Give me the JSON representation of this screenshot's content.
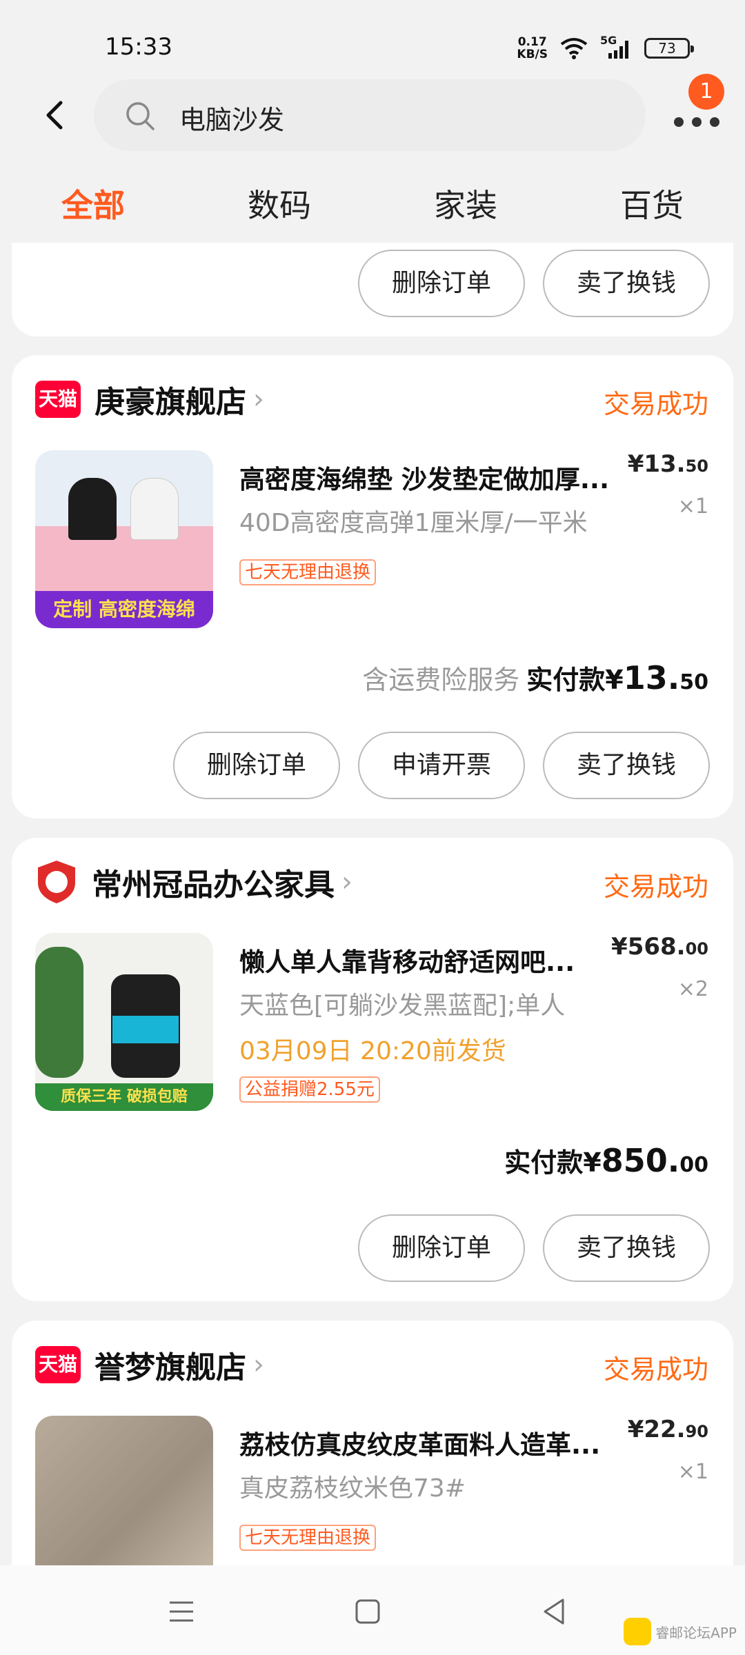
{
  "status": {
    "time": "15:33",
    "net_speed_value": "0.17",
    "net_speed_unit": "KB/S",
    "network": "5G",
    "battery": "73"
  },
  "header": {
    "search_text": "电脑沙发",
    "badge_count": "1"
  },
  "tabs": [
    {
      "label": "全部",
      "active": true
    },
    {
      "label": "数码",
      "active": false
    },
    {
      "label": "家装",
      "active": false
    },
    {
      "label": "百货",
      "active": false
    }
  ],
  "card0": {
    "btn_delete": "删除订单",
    "btn_sell": "卖了换钱"
  },
  "card1": {
    "shop_logo": "天猫",
    "shop_name": "庚豪旗舰店",
    "status": "交易成功",
    "thumb_text": "定制 高密度海绵",
    "title": "高密度海绵垫 沙发垫定做加厚...",
    "spec": "40D高密度高弹1厘米厚/一平米",
    "tag": "七天无理由退换",
    "price_int": "¥13.",
    "price_dec": "50",
    "qty": "×1",
    "pay_note": "含运费险服务",
    "pay_label": "实付款¥",
    "pay_int": "13.",
    "pay_dec": "50",
    "btn_delete": "删除订单",
    "btn_invoice": "申请开票",
    "btn_sell": "卖了换钱"
  },
  "card2": {
    "shop_logo": "企",
    "shop_name": "常州冠品办公家具",
    "status": "交易成功",
    "thumb_text": "质保三年 破损包赔",
    "title": "懒人单人靠背移动舒适网吧...",
    "spec": "天蓝色[可躺沙发黑蓝配];单人",
    "ship": "03月09日 20:20前发货",
    "tag": "公益捐赠2.55元",
    "price_int": "¥568.",
    "price_dec": "00",
    "qty": "×2",
    "pay_label": "实付款¥",
    "pay_int": "850.",
    "pay_dec": "00",
    "btn_delete": "删除订单",
    "btn_sell": "卖了换钱"
  },
  "card3": {
    "shop_logo": "天猫",
    "shop_name": "誉梦旗舰店",
    "status": "交易成功",
    "title": "荔枝仿真皮纹皮革面料人造革...",
    "spec": "真皮荔枝纹米色73#",
    "tag": "七天无理由退换",
    "price_int": "¥22.",
    "price_dec": "90",
    "qty": "×1"
  },
  "watermark": {
    "text": "睿邮论坛APP"
  },
  "colors": {
    "accent": "#ff5a1f",
    "status": "#ff6a14",
    "ship": "#f0a12c",
    "tmall": "#ff0036"
  }
}
